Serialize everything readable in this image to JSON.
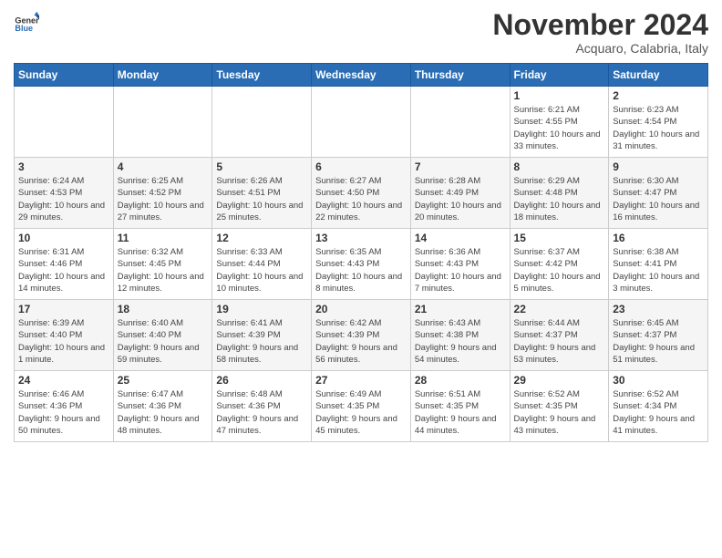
{
  "logo": {
    "general": "General",
    "blue": "Blue"
  },
  "header": {
    "month": "November 2024",
    "location": "Acquaro, Calabria, Italy"
  },
  "weekdays": [
    "Sunday",
    "Monday",
    "Tuesday",
    "Wednesday",
    "Thursday",
    "Friday",
    "Saturday"
  ],
  "weeks": [
    [
      {
        "day": "",
        "info": ""
      },
      {
        "day": "",
        "info": ""
      },
      {
        "day": "",
        "info": ""
      },
      {
        "day": "",
        "info": ""
      },
      {
        "day": "",
        "info": ""
      },
      {
        "day": "1",
        "info": "Sunrise: 6:21 AM\nSunset: 4:55 PM\nDaylight: 10 hours and 33 minutes."
      },
      {
        "day": "2",
        "info": "Sunrise: 6:23 AM\nSunset: 4:54 PM\nDaylight: 10 hours and 31 minutes."
      }
    ],
    [
      {
        "day": "3",
        "info": "Sunrise: 6:24 AM\nSunset: 4:53 PM\nDaylight: 10 hours and 29 minutes."
      },
      {
        "day": "4",
        "info": "Sunrise: 6:25 AM\nSunset: 4:52 PM\nDaylight: 10 hours and 27 minutes."
      },
      {
        "day": "5",
        "info": "Sunrise: 6:26 AM\nSunset: 4:51 PM\nDaylight: 10 hours and 25 minutes."
      },
      {
        "day": "6",
        "info": "Sunrise: 6:27 AM\nSunset: 4:50 PM\nDaylight: 10 hours and 22 minutes."
      },
      {
        "day": "7",
        "info": "Sunrise: 6:28 AM\nSunset: 4:49 PM\nDaylight: 10 hours and 20 minutes."
      },
      {
        "day": "8",
        "info": "Sunrise: 6:29 AM\nSunset: 4:48 PM\nDaylight: 10 hours and 18 minutes."
      },
      {
        "day": "9",
        "info": "Sunrise: 6:30 AM\nSunset: 4:47 PM\nDaylight: 10 hours and 16 minutes."
      }
    ],
    [
      {
        "day": "10",
        "info": "Sunrise: 6:31 AM\nSunset: 4:46 PM\nDaylight: 10 hours and 14 minutes."
      },
      {
        "day": "11",
        "info": "Sunrise: 6:32 AM\nSunset: 4:45 PM\nDaylight: 10 hours and 12 minutes."
      },
      {
        "day": "12",
        "info": "Sunrise: 6:33 AM\nSunset: 4:44 PM\nDaylight: 10 hours and 10 minutes."
      },
      {
        "day": "13",
        "info": "Sunrise: 6:35 AM\nSunset: 4:43 PM\nDaylight: 10 hours and 8 minutes."
      },
      {
        "day": "14",
        "info": "Sunrise: 6:36 AM\nSunset: 4:43 PM\nDaylight: 10 hours and 7 minutes."
      },
      {
        "day": "15",
        "info": "Sunrise: 6:37 AM\nSunset: 4:42 PM\nDaylight: 10 hours and 5 minutes."
      },
      {
        "day": "16",
        "info": "Sunrise: 6:38 AM\nSunset: 4:41 PM\nDaylight: 10 hours and 3 minutes."
      }
    ],
    [
      {
        "day": "17",
        "info": "Sunrise: 6:39 AM\nSunset: 4:40 PM\nDaylight: 10 hours and 1 minute."
      },
      {
        "day": "18",
        "info": "Sunrise: 6:40 AM\nSunset: 4:40 PM\nDaylight: 9 hours and 59 minutes."
      },
      {
        "day": "19",
        "info": "Sunrise: 6:41 AM\nSunset: 4:39 PM\nDaylight: 9 hours and 58 minutes."
      },
      {
        "day": "20",
        "info": "Sunrise: 6:42 AM\nSunset: 4:39 PM\nDaylight: 9 hours and 56 minutes."
      },
      {
        "day": "21",
        "info": "Sunrise: 6:43 AM\nSunset: 4:38 PM\nDaylight: 9 hours and 54 minutes."
      },
      {
        "day": "22",
        "info": "Sunrise: 6:44 AM\nSunset: 4:37 PM\nDaylight: 9 hours and 53 minutes."
      },
      {
        "day": "23",
        "info": "Sunrise: 6:45 AM\nSunset: 4:37 PM\nDaylight: 9 hours and 51 minutes."
      }
    ],
    [
      {
        "day": "24",
        "info": "Sunrise: 6:46 AM\nSunset: 4:36 PM\nDaylight: 9 hours and 50 minutes."
      },
      {
        "day": "25",
        "info": "Sunrise: 6:47 AM\nSunset: 4:36 PM\nDaylight: 9 hours and 48 minutes."
      },
      {
        "day": "26",
        "info": "Sunrise: 6:48 AM\nSunset: 4:36 PM\nDaylight: 9 hours and 47 minutes."
      },
      {
        "day": "27",
        "info": "Sunrise: 6:49 AM\nSunset: 4:35 PM\nDaylight: 9 hours and 45 minutes."
      },
      {
        "day": "28",
        "info": "Sunrise: 6:51 AM\nSunset: 4:35 PM\nDaylight: 9 hours and 44 minutes."
      },
      {
        "day": "29",
        "info": "Sunrise: 6:52 AM\nSunset: 4:35 PM\nDaylight: 9 hours and 43 minutes."
      },
      {
        "day": "30",
        "info": "Sunrise: 6:52 AM\nSunset: 4:34 PM\nDaylight: 9 hours and 41 minutes."
      }
    ]
  ]
}
